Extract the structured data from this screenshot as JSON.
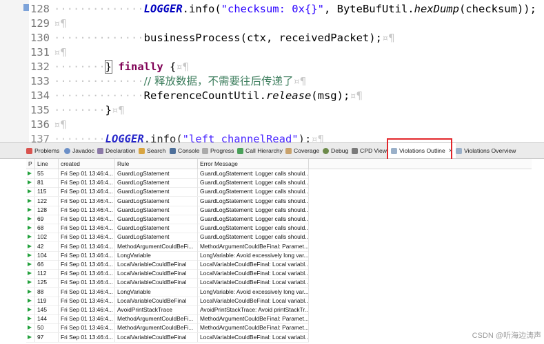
{
  "editor": {
    "lines": [
      {
        "num": "128",
        "indent": "··············",
        "text": "LOGGER.info(\"checksum: 0x{}\", ByteBufUtil.hexDump(checksum));"
      },
      {
        "num": "129",
        "indent": "",
        "text": ""
      },
      {
        "num": "130",
        "indent": "··············",
        "text": "businessProcess(ctx, receivedPacket);"
      },
      {
        "num": "131",
        "indent": "",
        "text": ""
      },
      {
        "num": "132",
        "indent": "········",
        "text": "} finally {"
      },
      {
        "num": "133",
        "indent": "··············",
        "text": "// 释放数据，不需要往后传递了"
      },
      {
        "num": "134",
        "indent": "··············",
        "text": "ReferenceCountUtil.release(msg);"
      },
      {
        "num": "135",
        "indent": "········",
        "text": "}"
      },
      {
        "num": "136",
        "indent": "",
        "text": ""
      },
      {
        "num": "137",
        "indent": "········",
        "text": "LOGGER.info(\"left channelRead\");"
      }
    ],
    "tokens": {
      "logger": "LOGGER",
      "info_open": ".info(",
      "checksum_str": "\"checksum: 0x{}\"",
      "comma_sp": ", ",
      "bytebuf": "ByteBufUtil.",
      "hexdump": "hexDump",
      "checksum_arg": "(checksum));",
      "business": "businessProcess(ctx, receivedPacket);",
      "finally_brace": "} ",
      "finally_kw": "finally",
      "finally_open": " {",
      "comment": "// 释放数据，不需要往后传递了",
      "refcount": "ReferenceCountUtil.",
      "release": "release",
      "release_args": "(msg);",
      "close_brace": "}",
      "left_str": "\"left channelRead\"",
      "close_paren": ");",
      "pilcrow": "¤¶"
    }
  },
  "tabs": [
    {
      "label": "Problems"
    },
    {
      "label": "Javadoc"
    },
    {
      "label": "Declaration"
    },
    {
      "label": "Search"
    },
    {
      "label": "Console"
    },
    {
      "label": "Progress"
    },
    {
      "label": "Call Hierarchy"
    },
    {
      "label": "Coverage"
    },
    {
      "label": "Debug"
    },
    {
      "label": "CPD View"
    },
    {
      "label": "Violations Outline",
      "active": true
    },
    {
      "label": "Violations Overview"
    }
  ],
  "tab_close_glyph": "×",
  "table": {
    "columns": [
      "P",
      "Line",
      "created",
      "Rule",
      "Error Message"
    ],
    "rows": [
      {
        "line": "55",
        "created": "Fri Sep 01 13:46:4...",
        "rule": "GuardLogStatement",
        "msg": "GuardLogStatement: Logger calls should..."
      },
      {
        "line": "81",
        "created": "Fri Sep 01 13:46:4...",
        "rule": "GuardLogStatement",
        "msg": "GuardLogStatement: Logger calls should..."
      },
      {
        "line": "115",
        "created": "Fri Sep 01 13:46:4...",
        "rule": "GuardLogStatement",
        "msg": "GuardLogStatement: Logger calls should..."
      },
      {
        "line": "122",
        "created": "Fri Sep 01 13:46:4...",
        "rule": "GuardLogStatement",
        "msg": "GuardLogStatement: Logger calls should..."
      },
      {
        "line": "128",
        "created": "Fri Sep 01 13:46:4...",
        "rule": "GuardLogStatement",
        "msg": "GuardLogStatement: Logger calls should..."
      },
      {
        "line": "69",
        "created": "Fri Sep 01 13:46:4...",
        "rule": "GuardLogStatement",
        "msg": "GuardLogStatement: Logger calls should..."
      },
      {
        "line": "68",
        "created": "Fri Sep 01 13:46:4...",
        "rule": "GuardLogStatement",
        "msg": "GuardLogStatement: Logger calls should..."
      },
      {
        "line": "102",
        "created": "Fri Sep 01 13:46:4...",
        "rule": "GuardLogStatement",
        "msg": "GuardLogStatement: Logger calls should..."
      },
      {
        "line": "42",
        "created": "Fri Sep 01 13:46:4...",
        "rule": "MethodArgumentCouldBeFi...",
        "msg": "MethodArgumentCouldBeFinal: Paramet..."
      },
      {
        "line": "104",
        "created": "Fri Sep 01 13:46:4...",
        "rule": "LongVariable",
        "msg": "LongVariable: Avoid excessively long var..."
      },
      {
        "line": "66",
        "created": "Fri Sep 01 13:46:4...",
        "rule": "LocalVariableCouldBeFinal",
        "msg": "LocalVariableCouldBeFinal: Local variabl..."
      },
      {
        "line": "112",
        "created": "Fri Sep 01 13:46:4...",
        "rule": "LocalVariableCouldBeFinal",
        "msg": "LocalVariableCouldBeFinal: Local variabl..."
      },
      {
        "line": "125",
        "created": "Fri Sep 01 13:46:4...",
        "rule": "LocalVariableCouldBeFinal",
        "msg": "LocalVariableCouldBeFinal: Local variabl..."
      },
      {
        "line": "88",
        "created": "Fri Sep 01 13:46:4...",
        "rule": "LongVariable",
        "msg": "LongVariable: Avoid excessively long var..."
      },
      {
        "line": "119",
        "created": "Fri Sep 01 13:46:4...",
        "rule": "LocalVariableCouldBeFinal",
        "msg": "LocalVariableCouldBeFinal: Local variabl..."
      },
      {
        "line": "145",
        "created": "Fri Sep 01 13:46:4...",
        "rule": "AvoidPrintStackTrace",
        "msg": "AvoidPrintStackTrace: Avoid printStackTr..."
      },
      {
        "line": "144",
        "created": "Fri Sep 01 13:46:4...",
        "rule": "MethodArgumentCouldBeFi...",
        "msg": "MethodArgumentCouldBeFinal: Paramet..."
      },
      {
        "line": "50",
        "created": "Fri Sep 01 13:46:4...",
        "rule": "MethodArgumentCouldBeFi...",
        "msg": "MethodArgumentCouldBeFinal: Paramet..."
      },
      {
        "line": "97",
        "created": "Fri Sep 01 13:46:4...",
        "rule": "LocalVariableCouldBeFinal",
        "msg": "LocalVariableCouldBeFinal: Local variabl..."
      }
    ]
  },
  "watermark": "CSDN @听海边涛声",
  "colors": {
    "keyword": "#7f0055",
    "string": "#2a00ff",
    "comment": "#3f7f5f",
    "field": "#0000c0",
    "priority_marker": "#23a13c",
    "highlight_box": "#e3262b"
  },
  "icons": {
    "problems": "problems-icon",
    "javadoc": "javadoc-icon",
    "declaration": "declaration-icon",
    "search": "search-icon",
    "console": "console-icon",
    "progress": "progress-icon",
    "call_hierarchy": "call-hierarchy-icon",
    "coverage": "coverage-icon",
    "debug": "debug-icon",
    "cpd_view": "cpd-view-icon",
    "violations_outline": "violations-outline-icon",
    "violations_overview": "violations-overview-icon"
  }
}
